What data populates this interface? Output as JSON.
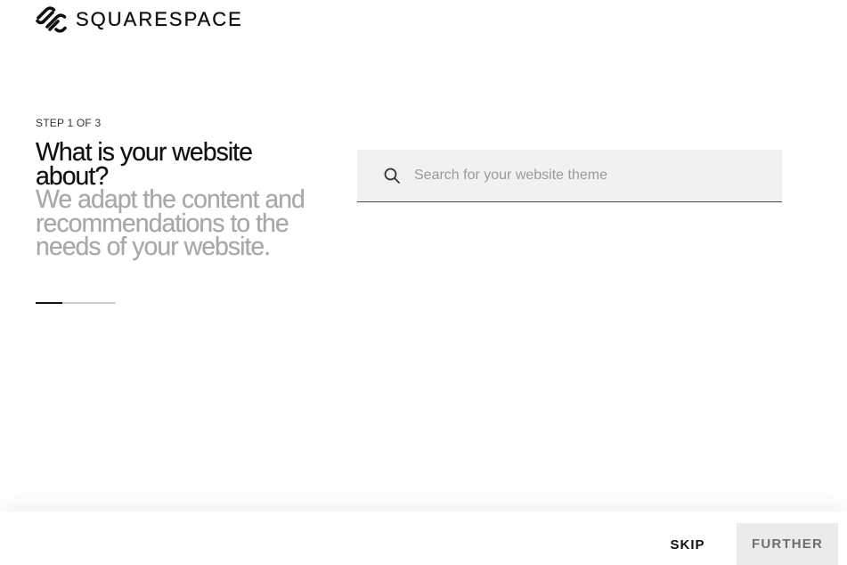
{
  "brand": {
    "name": "SQUARESPACE",
    "logo_icon": "squarespace-logo-icon"
  },
  "onboarding": {
    "step_label": "STEP 1 OF 3",
    "title": "What is your website about?",
    "subtitle": "We adapt the content and recommendations to the needs of your website.",
    "progress_fraction": 0.33
  },
  "search": {
    "icon": "search-icon",
    "placeholder": "Search for your website theme",
    "value": ""
  },
  "footer": {
    "skip_label": "SKIP",
    "further_label": "FURTHER"
  },
  "colors": {
    "accent": "#111111",
    "subtitle": "#a8a8a8",
    "search_bg": "#f1f1f1",
    "further_bg": "#ebebeb",
    "further_text": "#6e6e6e"
  }
}
